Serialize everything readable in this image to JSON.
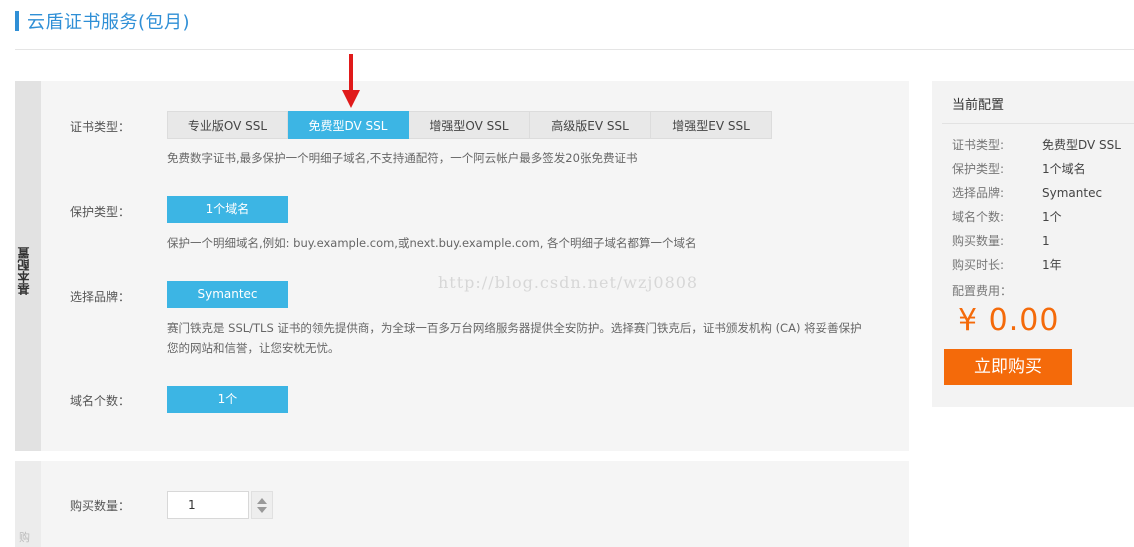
{
  "header": {
    "title": "云盾证书服务(包月)"
  },
  "config": {
    "side_label": "基本配置",
    "cert_type": {
      "label": "证书类型：",
      "options": [
        "专业版OV SSL",
        "免费型DV SSL",
        "增强型OV SSL",
        "高级版EV SSL",
        "增强型EV SSL"
      ],
      "selected": "免费型DV SSL",
      "hint": "免费数字证书,最多保护一个明细子域名,不支持通配符，一个阿云帐户最多签发20张免费证书"
    },
    "protect_type": {
      "label": "保护类型：",
      "value": "1个域名",
      "hint": "保护一个明细域名,例如: buy.example.com,或next.buy.example.com, 各个明细子域名都算一个域名"
    },
    "brand": {
      "label": "选择品牌：",
      "value": "Symantec",
      "hint_line1": "赛门铁克是 SSL/TLS 证书的领先提供商，为全球一百多万台网络服务器提供全安防护。选择赛门铁克后，证书颁发机构 (CA) 将妥善保护",
      "hint_line2": "您的网站和信誉，让您安枕无忧。"
    },
    "domain_count": {
      "label": "域名个数：",
      "value": "1个"
    }
  },
  "watermark": "http://blog.csdn.net/wzj0808",
  "purchase": {
    "side_label": "购",
    "qty_label": "购买数量：",
    "qty_value": "1"
  },
  "summary": {
    "title": "当前配置",
    "rows": [
      {
        "key": "证书类型:",
        "value": "免费型DV SSL"
      },
      {
        "key": "保护类型:",
        "value": "1个域名"
      },
      {
        "key": "选择品牌:",
        "value": "Symantec"
      },
      {
        "key": "域名个数:",
        "value": "1个"
      },
      {
        "key": "购买数量:",
        "value": "1"
      },
      {
        "key": "购买时长:",
        "value": "1年"
      }
    ],
    "fee_label": "配置费用：",
    "price": "¥ 0.00",
    "buy_button": "立即购买"
  },
  "colors": {
    "accent": "#3cb5e4",
    "title": "#2f8fd6",
    "price": "#f46a0a",
    "arrow": "#e01a1a"
  }
}
